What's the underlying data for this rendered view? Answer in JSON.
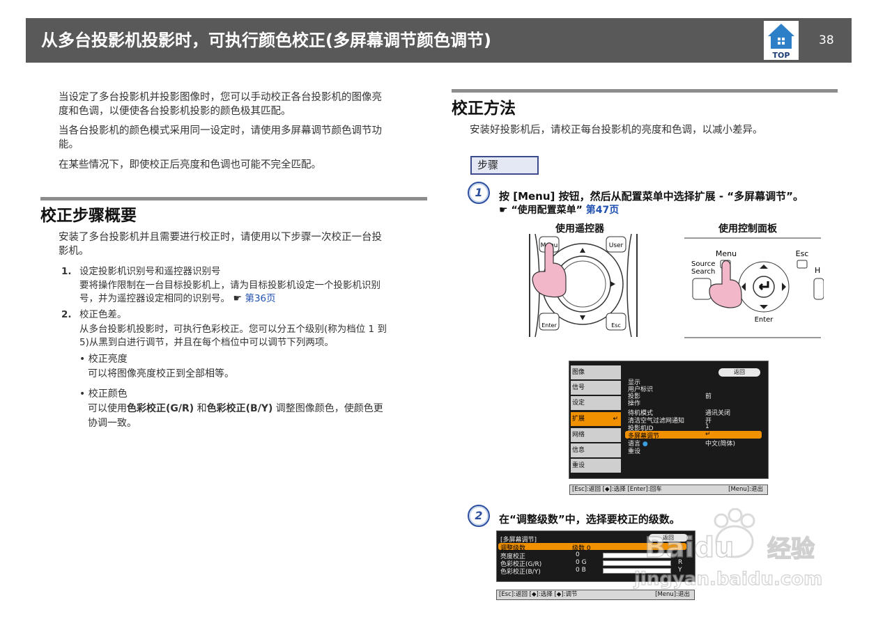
{
  "header": {
    "title": "从多台投影机投影时，可执行颜色校正(多屏幕调节颜色调节)",
    "top_label": "TOP",
    "page_number": "38"
  },
  "intro": {
    "p1": "当设定了多台投影机并投影图像时，您可以手动校正各台投影机的图像亮",
    "p1b": "度和色调，以便使各台投影机投影的颜色极其匹配。",
    "p2": "当各台投影机的颜色模式采用同一设定时，请使用多屏幕调节颜色调节功",
    "p2b": "能。",
    "p3": "在某些情况下，即使校正后亮度和色调也可能不完全匹配。"
  },
  "overview": {
    "heading": "校正步骤概要",
    "intro_a": "安装了多台投影机并且需要进行校正时，请使用以下步骤一次校正一台投",
    "intro_b": "影机。",
    "items": [
      {
        "num": "1.",
        "title": "设定投影机识别号和遥控器识别号",
        "body_a": "要将操作限制在一台目标投影机上，请为目标投影机设定一个投影机识别",
        "body_b": "号，并为遥控器设定相同的识别号。",
        "link": "第36页"
      },
      {
        "num": "2.",
        "title": "校正色差。",
        "body_a": "从多台投影机投影时，可执行色彩校正。您可以分五个级别(称为档位 1 到",
        "body_b": "5)从黑到白进行调节，并且在每个档位中可以调节下列两项。"
      }
    ],
    "bullets": [
      {
        "title": "校正亮度",
        "body": "可以将图像亮度校正到全部相等。"
      },
      {
        "title": "校正颜色",
        "body_pre": "可以使用",
        "b1": "色彩校正(G/R)",
        "mid": " 和",
        "b2": "色彩校正(B/Y)",
        "body_post": " 调整图像颜色，使颜色更",
        "body_c": "协调一致。"
      }
    ]
  },
  "method": {
    "heading": "校正方法",
    "intro": "安装好投影机后，请校正每台投影机的亮度和色调，以减小差异。",
    "steps_label": "步骤",
    "step1": {
      "num": "1",
      "text": "按 [Menu] 按钮，然后从配置菜单中选择扩展 - “多屏幕调节”。",
      "ref_text": "“使用配置菜单”",
      "ref_link": "第47页"
    },
    "remote_title": "使用遥控器",
    "panel_title": "使用控制面板",
    "remote_labels": {
      "menu": "Menu",
      "user": "User",
      "enter": "Enter",
      "esc": "Esc"
    },
    "panel_labels": {
      "menu": "Menu",
      "esc": "Esc",
      "source": "Source",
      "search": "Search",
      "enter": "Enter",
      "h": "H"
    },
    "step2": {
      "num": "2",
      "text": "在“调整级数”中，选择要校正的级数。"
    }
  },
  "config_menu": {
    "tabs": [
      "图像",
      "信号",
      "设定",
      "扩展",
      "网络",
      "信息",
      "重设"
    ],
    "return_label": "返回",
    "rows": [
      {
        "label": "显示",
        "value": ""
      },
      {
        "label": "用户标识",
        "value": ""
      },
      {
        "label": "投影",
        "value": "前"
      },
      {
        "label": "操作",
        "value": ""
      },
      {
        "label": "待机模式",
        "value": "通讯关闭"
      },
      {
        "label": "清洁空气过滤网通知",
        "value": "开"
      },
      {
        "label": "投影机ID",
        "value": "1"
      },
      {
        "label": "多屏幕调节",
        "value": "↵"
      },
      {
        "label": "语言",
        "value": "中文(简体)"
      },
      {
        "label": "重设",
        "value": ""
      }
    ],
    "help_left": "[Esc]:返回 [◆]:选择 [Enter]:回车",
    "help_right": "[Menu]:退出"
  },
  "multiscreen_menu": {
    "title": "[多屏幕调节]",
    "return_label": "返回",
    "rows": [
      {
        "label": "调整级数",
        "value": "级数 0",
        "end": ""
      },
      {
        "label": "亮度校正",
        "value": "0",
        "end": ""
      },
      {
        "label": "色彩校正(G/R)",
        "value": "0 G",
        "end": "R"
      },
      {
        "label": "色彩校正(B/Y)",
        "value": "0 B",
        "end": "Y"
      }
    ],
    "help_left": "[Esc]:返回 [◆]:选择 [◆]:调节",
    "help_right": "[Menu]:退出"
  },
  "watermark": {
    "brand": "Baidu",
    "cn": "经验",
    "url": "jingyan.baidu.com"
  }
}
